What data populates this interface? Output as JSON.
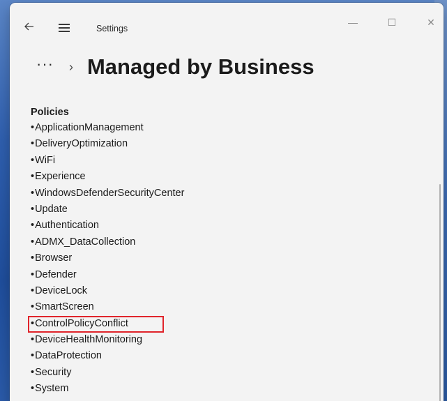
{
  "window": {
    "app_title": "Settings",
    "minimize_glyph": "—",
    "maximize_glyph": "☐",
    "close_glyph": "✕"
  },
  "breadcrumb": {
    "more": "···",
    "separator": "›",
    "title": "Managed by Business"
  },
  "section": {
    "label": "Policies"
  },
  "policies": [
    "ApplicationManagement",
    "DeliveryOptimization",
    "WiFi",
    "Experience",
    "WindowsDefenderSecurityCenter",
    "Update",
    "Authentication",
    "ADMX_DataCollection",
    "Browser",
    "Defender",
    "DeviceLock",
    "SmartScreen",
    "ControlPolicyConflict",
    "DeviceHealthMonitoring",
    "DataProtection",
    "Security",
    "System"
  ],
  "bullet": "•",
  "highlighted_policy": "ControlPolicyConflict",
  "colors": {
    "highlight_border": "#e0242b"
  }
}
